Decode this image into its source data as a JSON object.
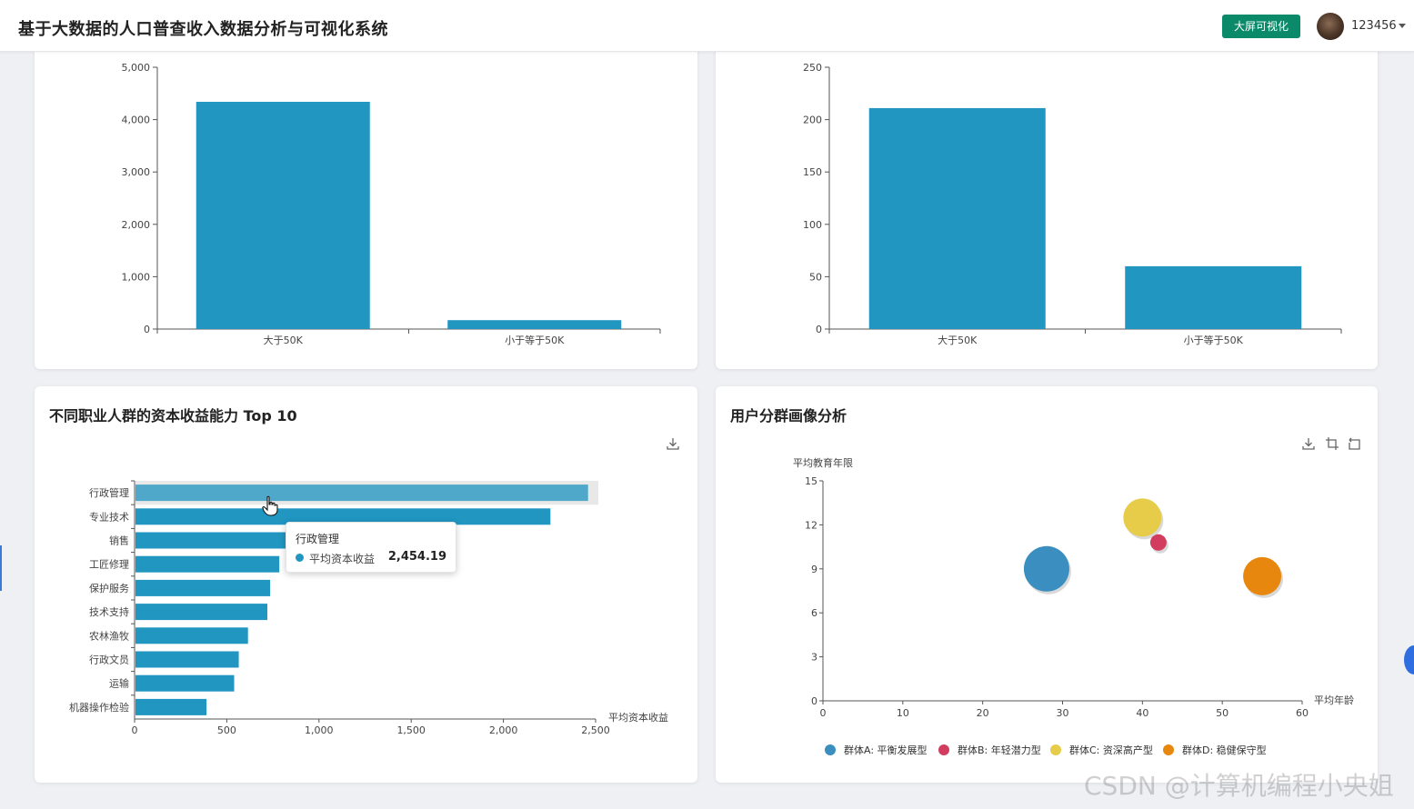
{
  "header": {
    "title": "基于大数据的人口普查收入数据分析与可视化系统",
    "screen_button": "大屏可视化",
    "username": "123456"
  },
  "cards": {
    "top_left": {
      "title": ""
    },
    "top_right": {
      "title": ""
    },
    "bottom_left": {
      "title": "不同职业人群的资本收益能力 Top 10"
    },
    "bottom_right": {
      "title": "用户分群画像分析"
    }
  },
  "tooltip": {
    "title": "行政管理",
    "series": "平均资本收益",
    "value": "2,454.19"
  },
  "watermark": "CSDN @计算机编程小央姐",
  "colors": {
    "bar": "#2196c1",
    "accent": "#0b8a6a",
    "groupA": "#3a8fc0",
    "groupB": "#d23c5e",
    "groupC": "#e6cc48",
    "groupD": "#e8870e"
  },
  "chart_data": [
    {
      "type": "bar",
      "categories": [
        "大于50K",
        "小于等于50K"
      ],
      "values": [
        4340,
        170
      ],
      "ylim": [
        0,
        5000
      ],
      "yticks": [
        "0",
        "1,000",
        "2,000",
        "3,000",
        "4,000",
        "5,000"
      ]
    },
    {
      "type": "bar",
      "categories": [
        "大于50K",
        "小于等于50K"
      ],
      "values": [
        211,
        60
      ],
      "ylim": [
        0,
        250
      ],
      "yticks": [
        "0",
        "50",
        "100",
        "150",
        "200",
        "250"
      ]
    },
    {
      "type": "bar",
      "orientation": "horizontal",
      "title": "不同职业人群的资本收益能力 Top 10",
      "xlabel": "平均资本收益",
      "categories": [
        "行政管理",
        "专业技术",
        "销售",
        "工匠修理",
        "保护服务",
        "技术支持",
        "农林渔牧",
        "行政文员",
        "运输",
        "机器操作检验"
      ],
      "values": [
        2454.19,
        2250,
        870,
        780,
        730,
        715,
        610,
        560,
        535,
        385
      ],
      "xlim": [
        0,
        2500
      ],
      "xticks": [
        "0",
        "500",
        "1,000",
        "1,500",
        "2,000",
        "2,500"
      ],
      "highlighted": "行政管理"
    },
    {
      "type": "scatter",
      "title": "用户分群画像分析",
      "xlabel": "平均年龄",
      "ylabel": "平均教育年限",
      "xlim": [
        0,
        60
      ],
      "ylim": [
        0,
        15
      ],
      "xticks": [
        "0",
        "10",
        "20",
        "30",
        "40",
        "50",
        "60"
      ],
      "yticks": [
        "0",
        "3",
        "6",
        "9",
        "12",
        "15"
      ],
      "series": [
        {
          "name": "群体A: 平衡发展型",
          "x": 28,
          "y": 9,
          "size": "large",
          "color": "#3a8fc0"
        },
        {
          "name": "群体B: 年轻潜力型",
          "x": 42,
          "y": 10.8,
          "size": "small",
          "color": "#d23c5e"
        },
        {
          "name": "群体C: 资深高产型",
          "x": 40,
          "y": 12.5,
          "size": "medium",
          "color": "#e6cc48"
        },
        {
          "name": "群体D: 稳健保守型",
          "x": 55,
          "y": 8.5,
          "size": "medium",
          "color": "#e8870e"
        }
      ]
    }
  ]
}
